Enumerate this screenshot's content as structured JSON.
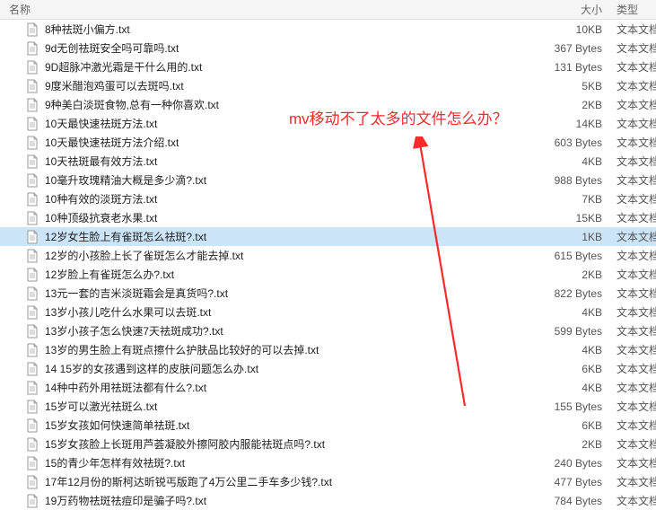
{
  "header": {
    "name": "名称",
    "size": "大小",
    "type": "类型"
  },
  "type_label": "文本文档",
  "annotation_text": "mv移动不了太多的文件怎么办？",
  "selected_index": 11,
  "files": [
    {
      "name": "8种祛斑小偏方.txt",
      "size": "10KB"
    },
    {
      "name": "9d无创祛斑安全吗可靠吗.txt",
      "size": "367 Bytes"
    },
    {
      "name": "9D超脉冲激光霜是干什么用的.txt",
      "size": "131 Bytes"
    },
    {
      "name": "9度米醋泡鸡蛋可以去斑吗.txt",
      "size": "5KB"
    },
    {
      "name": "9种美白淡斑食物,总有一种你喜欢.txt",
      "size": "2KB"
    },
    {
      "name": "10天最快速祛斑方法.txt",
      "size": "14KB"
    },
    {
      "name": "10天最快速祛斑方法介绍.txt",
      "size": "603 Bytes"
    },
    {
      "name": "10天祛斑最有效方法.txt",
      "size": "4KB"
    },
    {
      "name": "10毫升玫瑰精油大概是多少滴?.txt",
      "size": "988 Bytes"
    },
    {
      "name": "10种有效的淡斑方法.txt",
      "size": "7KB"
    },
    {
      "name": "10种顶级抗衰老水果.txt",
      "size": "15KB"
    },
    {
      "name": "12岁女生脸上有雀斑怎么祛斑?.txt",
      "size": "1KB"
    },
    {
      "name": "12岁的小孩脸上长了雀斑怎么才能去掉.txt",
      "size": "615 Bytes"
    },
    {
      "name": "12岁脸上有雀斑怎么办?.txt",
      "size": "2KB"
    },
    {
      "name": "13元一套的吉米淡斑霜会是真货吗?.txt",
      "size": "822 Bytes"
    },
    {
      "name": "13岁小孩儿吃什么水果可以去斑.txt",
      "size": "4KB"
    },
    {
      "name": "13岁小孩子怎么快速7天祛斑成功?.txt",
      "size": "599 Bytes"
    },
    {
      "name": "13岁的男生脸上有斑点擦什么护肤品比较好的可以去掉.txt",
      "size": "4KB"
    },
    {
      "name": "14 15岁的女孩遇到这样的皮肤问题怎么办.txt",
      "size": "6KB"
    },
    {
      "name": "14种中药外用祛斑法都有什么?.txt",
      "size": "4KB"
    },
    {
      "name": "15岁可以激光祛斑么.txt",
      "size": "155 Bytes"
    },
    {
      "name": "15岁女孩如何快速简单祛斑.txt",
      "size": "6KB"
    },
    {
      "name": "15岁女孩脸上长斑用芦荟凝胶外擦阿胶内服能祛斑点吗?.txt",
      "size": "2KB"
    },
    {
      "name": "15的青少年怎样有效祛斑?.txt",
      "size": "240 Bytes"
    },
    {
      "name": "17年12月份的斯柯达昕锐丐版跑了4万公里二手车多少钱?.txt",
      "size": "477 Bytes"
    },
    {
      "name": "19万药物祛斑祛痘印是骗子吗?.txt",
      "size": "784 Bytes"
    }
  ]
}
